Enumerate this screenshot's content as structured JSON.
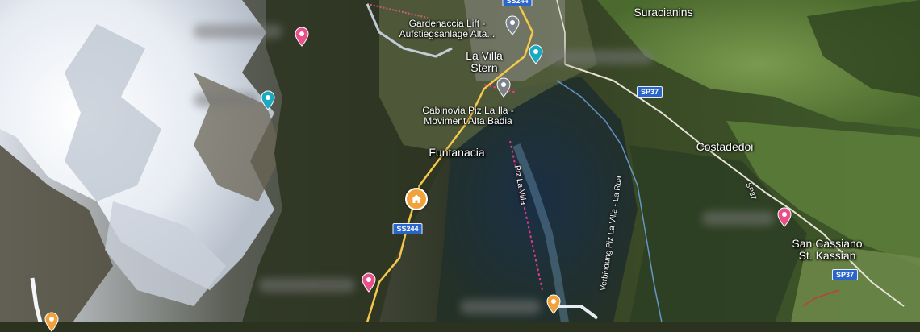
{
  "places": {
    "gardenaccia_line1": "Gardenaccia Lift -",
    "gardenaccia_line2": "Aufstiegsanlage Alta...",
    "la_villa": "La Villa",
    "stern": "Stern",
    "cabinovia_line1": "Cabinovia Piz La Ila -",
    "cabinovia_line2": "Moviment Alta Badia",
    "funtanacia": "Funtanacia",
    "suracianins": "Suracianins",
    "costadedoi": "Costadedoi",
    "san_cassiano": "San Cassiano",
    "st_kassian": "St. Kassian"
  },
  "roads": {
    "sp37_a": "SP37",
    "sp37_b": "SP37",
    "sp37_c": "SP37",
    "ss244_a": "SS244",
    "ss244_b": "SS244"
  },
  "trails": {
    "piz_la_villa": "Piz La Villa",
    "verbindung": "Verbindung Piz La Villa - La Rua"
  },
  "colors": {
    "pin_pink": "#e8508a",
    "pin_teal": "#1ba9bf",
    "pin_gray": "#7c8288",
    "pin_orange": "#f2a23c",
    "road_shield": "#2a66c9",
    "road_yellow": "#f5c84b"
  },
  "icons": {
    "home": "home-icon",
    "place_pin": "map-pin-icon"
  }
}
